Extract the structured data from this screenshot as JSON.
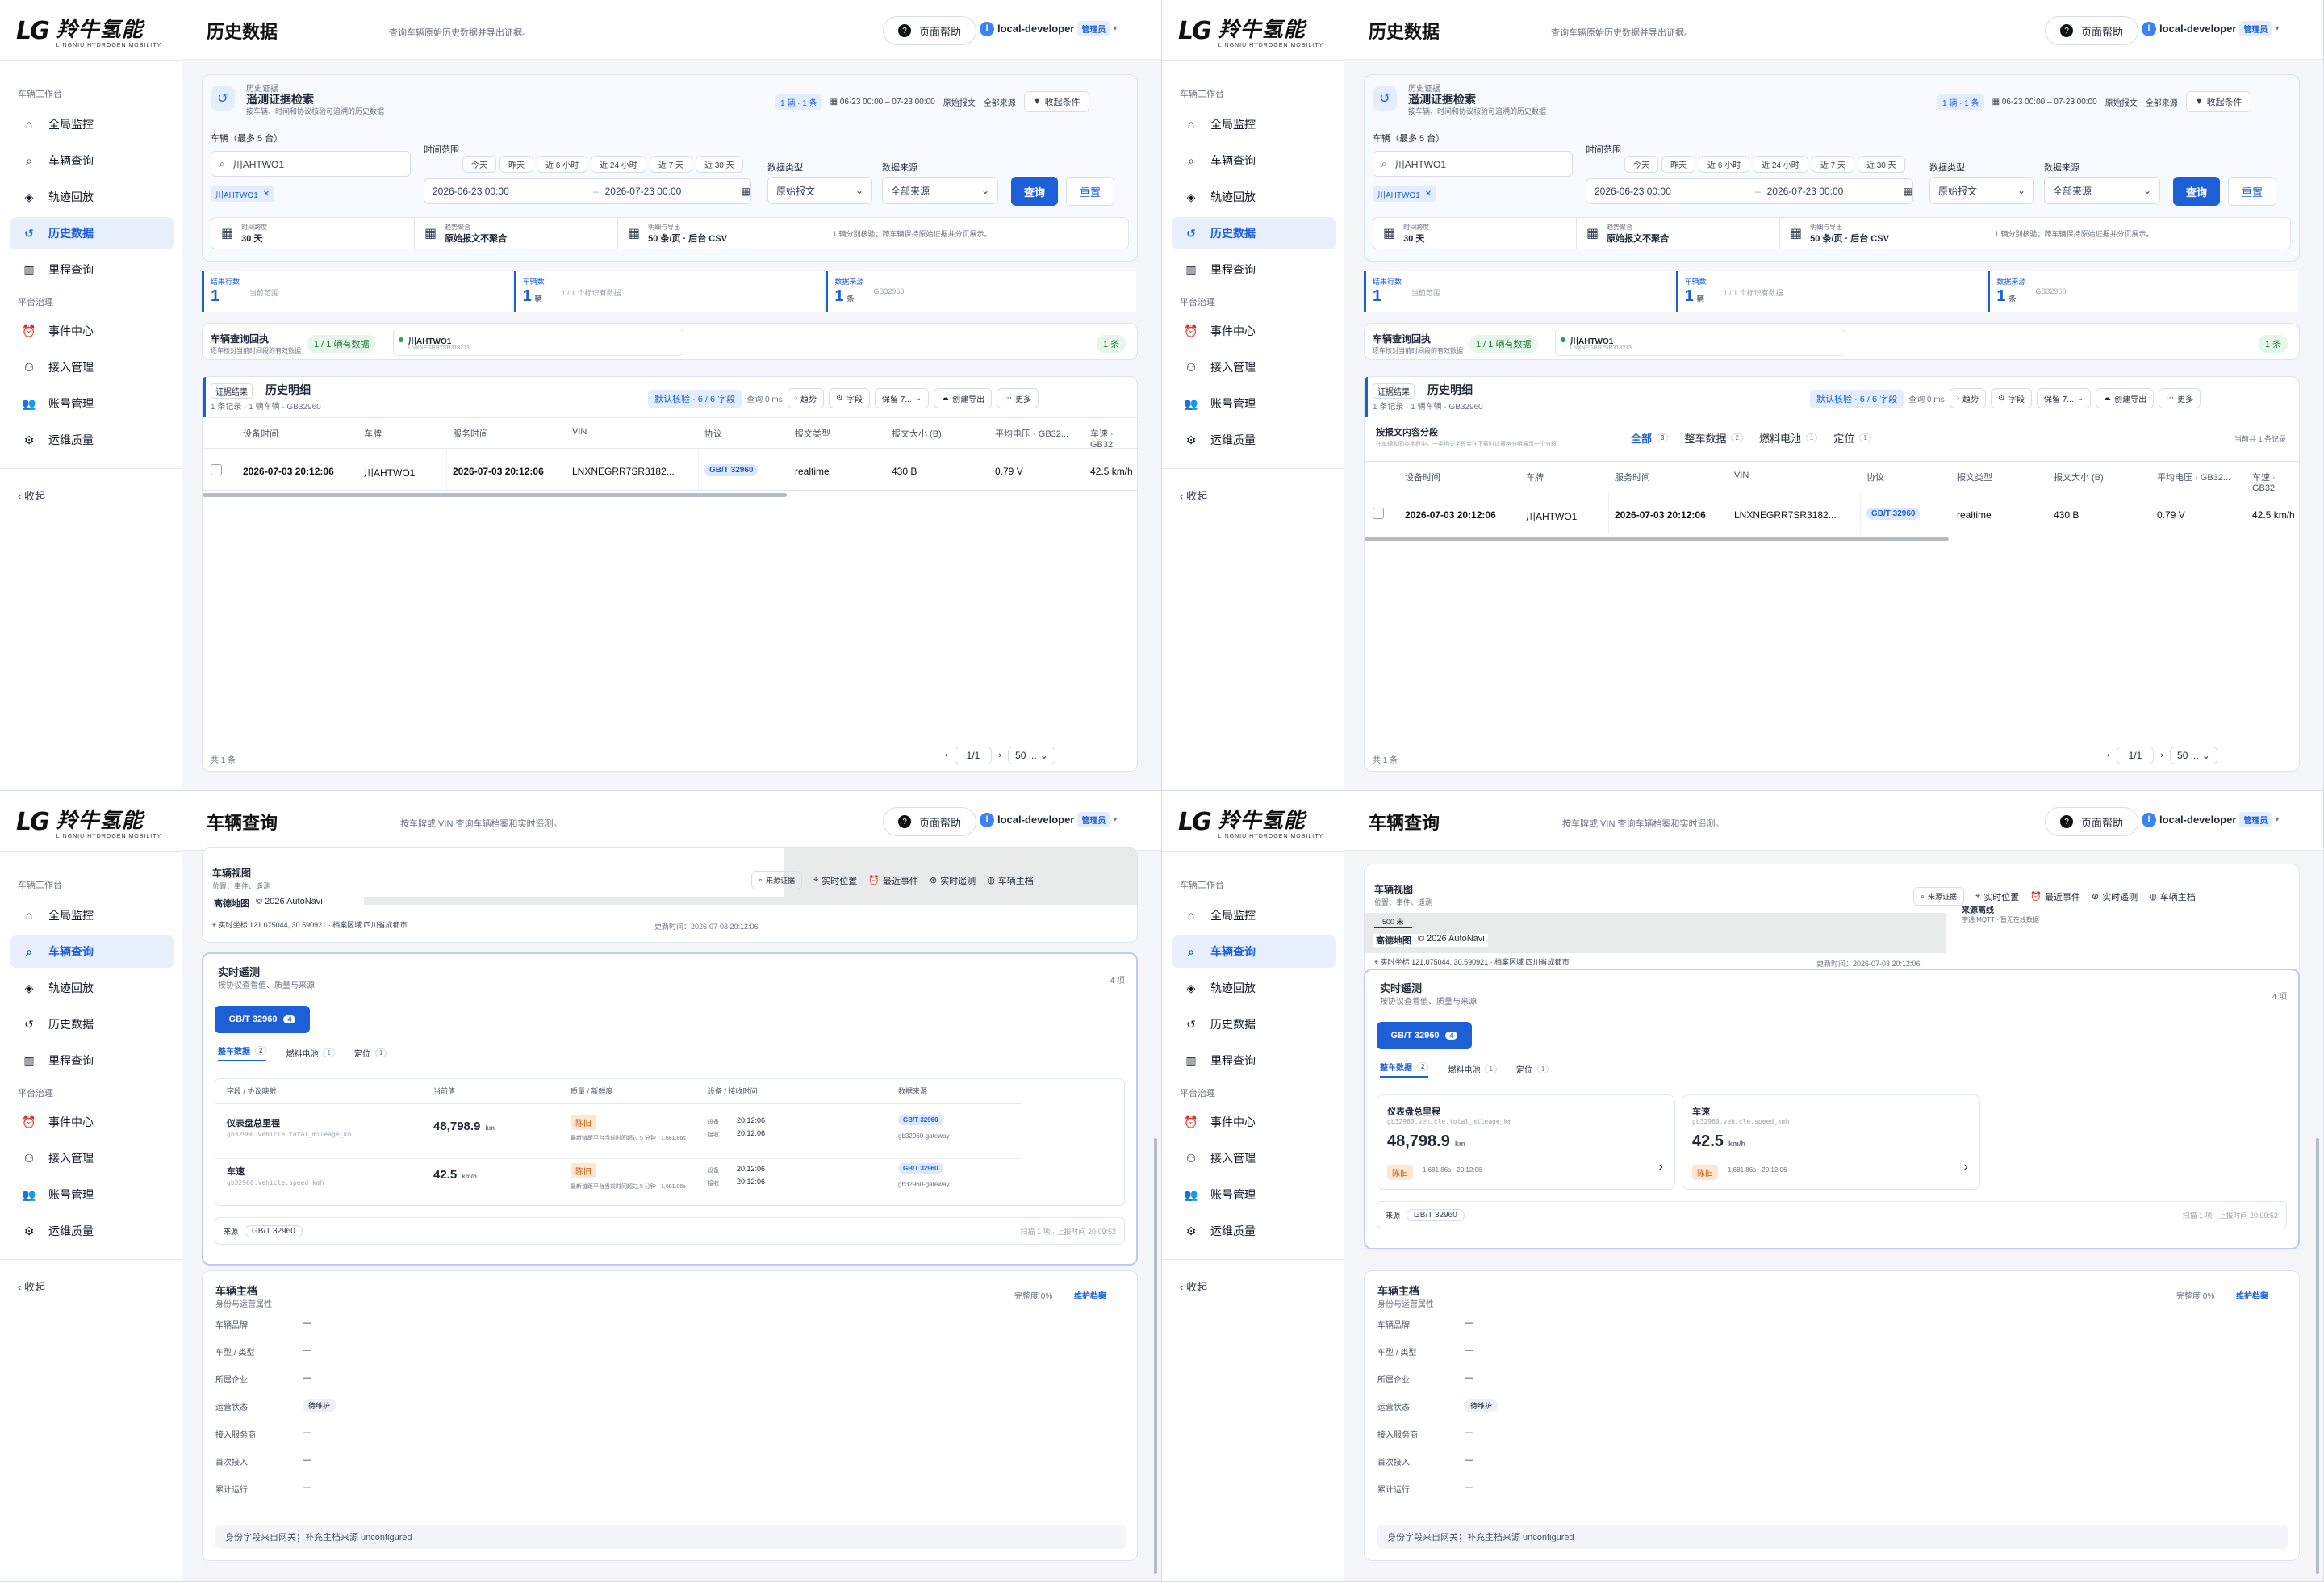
{
  "brand": {
    "mark": "LG",
    "name": "羚牛氢能",
    "en": "LINGNIU HYDROGEN MOBILITY"
  },
  "sidebar": {
    "section1": "车辆工作台",
    "section2": "平台治理",
    "items": [
      {
        "label": "全局监控",
        "icon": "home-icon"
      },
      {
        "label": "车辆查询",
        "icon": "search-icon"
      },
      {
        "label": "轨迹回放",
        "icon": "route-icon"
      },
      {
        "label": "历史数据",
        "icon": "history-icon"
      },
      {
        "label": "里程查询",
        "icon": "bar-chart-icon"
      }
    ],
    "items2": [
      {
        "label": "事件中心",
        "icon": "alarm-icon"
      },
      {
        "label": "接入管理",
        "icon": "plug-icon"
      },
      {
        "label": "账号管理",
        "icon": "users-icon"
      },
      {
        "label": "运维质量",
        "icon": "gear-icon"
      }
    ],
    "collapse": "收起"
  },
  "header": {
    "help": "页面帮助",
    "user": "local-developer",
    "role": "管理员",
    "avatar": "l"
  },
  "history": {
    "title": "历史数据",
    "subtitle": "查询车辆原始历史数据并导出证据。",
    "retrieve": {
      "eyebrow": "历史证据",
      "title": "遥测证据检索",
      "desc": "按车辆、时间和协议核验可追溯的历史数据",
      "stats": "1 辆 · 1 条",
      "range": "06-23 00:00 – 07-23 00:00",
      "raw": "原始报文",
      "src": "全部来源",
      "fold": "收起条件"
    },
    "filter": {
      "veh_label": "车辆（最多 5 台）",
      "veh_value": "川AHTWO1",
      "veh_chip": "川AHTWO1",
      "time_label": "时间范围",
      "quick": [
        "今天",
        "昨天",
        "近 6 小时",
        "近 24 小时",
        "近 7 天",
        "近 30 天"
      ],
      "start": "2026-06-23 00:00",
      "end": "2026-07-23 00:00",
      "dtype_label": "数据类型",
      "dtype": "原始报文",
      "src_label": "数据来源",
      "src": "全部来源",
      "query": "查询",
      "reset": "重置"
    },
    "meta": [
      {
        "k": "时间跨度",
        "v": "30 天"
      },
      {
        "k": "趋势聚合",
        "v": "原始报文不聚合"
      },
      {
        "k": "明细与导出",
        "v": "50 条/页 · 后台 CSV"
      }
    ],
    "meta_note": "1 辆分别核验；跨车辆保持原始证据并分页展示。",
    "kpis": [
      {
        "k": "结果行数",
        "v": "1",
        "n": "当前范围"
      },
      {
        "k": "车辆数",
        "v": "1",
        "u": "辆",
        "n": "1 / 1 个标识有数据"
      },
      {
        "k": "数据来源",
        "v": "1",
        "u": "条",
        "n": "GB32960"
      }
    ],
    "receipt": {
      "title": "车辆查询回执",
      "desc": "逐车核对当前时间段的有效数据",
      "badge": "1 / 1 辆有数据",
      "veh": "川AHTWO1",
      "vin": "LNXNEGRR7SR318213",
      "count": "1 条"
    },
    "detail": {
      "tag": "证据结果",
      "title": "历史明细",
      "sub": "1 条记录 · 1 辆车辆 · GB32960",
      "check": "默认核验 · 6 / 6 字段",
      "ms": "查询 0 ms",
      "trend": "趋势",
      "fields": "字段",
      "keep": "保留 7...",
      "export": "创建导出",
      "more": "更多"
    },
    "tabs_label": "按报文内容分段",
    "tabs_desc": "在车辆和同类字段中，一类相关字段会在下载时以表格分组展示一个分段。",
    "tabs": [
      {
        "t": "全部",
        "n": "3"
      },
      {
        "t": "整车数据",
        "n": "2"
      },
      {
        "t": "燃料电池",
        "n": "1"
      },
      {
        "t": "定位",
        "n": "1"
      }
    ],
    "tabs_note": "当前共 1 条记录",
    "cols": [
      "设备时间",
      "车牌",
      "服务时间",
      "VIN",
      "协议",
      "报文类型",
      "报文大小 (B)",
      "平均电压 · GB32...",
      "车速 · GB32"
    ],
    "row": [
      "2026-07-03 20:12:06",
      "川AHTWO1",
      "2026-07-03 20:12:06",
      "LNXNEGRR7SR3182...",
      "GB/T 32960",
      "realtime",
      "430 B",
      "0.79 V",
      "42.5 km/h"
    ],
    "total": "共 1 条",
    "page": "1/1",
    "size": "50 ..."
  },
  "vehicle": {
    "title": "车辆查询",
    "subtitle": "按车牌或 VIN 查询车辆档案和实时遥测。",
    "view": {
      "title": "车辆视图",
      "sub": "位置、事件、遥测",
      "btns": [
        "来源证据",
        "实时位置",
        "最近事件",
        "实时遥测",
        "车辆主档"
      ],
      "map": "高德地图",
      "copy": "© 2026 AutoNavi",
      "addr": "实时坐标 121.075044, 30.590921 · 档案区域 四川省成都市",
      "updated": "更新时间：2026-07-03 20:12:06",
      "scale": "500 米",
      "src_title": "来源离线",
      "src_sub": "宇通 MQTT · 暂无在线数据"
    },
    "rt": {
      "title": "实时遥测",
      "sub": "按协议查看值、质量与来源",
      "count": "4 项",
      "proto": "GB/T 32960",
      "proto_n": "4",
      "tabs": [
        {
          "t": "整车数据",
          "n": "2"
        },
        {
          "t": "燃料电池",
          "n": "1"
        },
        {
          "t": "定位",
          "n": "1"
        }
      ],
      "cols": [
        "字段 / 协议映射",
        "当前值",
        "质量 / 新鲜度",
        "设备 / 接收时间",
        "数据来源"
      ],
      "rows": [
        {
          "name": "仪表盘总里程",
          "key": "gb32960.vehicle.total_mileage_km",
          "val": "48,798.9",
          "unit": "km",
          "q": "陈旧",
          "qd": "最新值距平台当前时间超过 5 分钟 · 1,681.86s",
          "dev": "设备",
          "rec": "接收",
          "t1": "20:12:06",
          "t2": "20:12:06",
          "src": "GB/T 32960",
          "gw": "gb32960-gateway"
        },
        {
          "name": "车速",
          "key": "gb32960.vehicle.speed_kmh",
          "val": "42.5",
          "unit": "km/h",
          "q": "陈旧",
          "qd": "最新值距平台当前时间超过 5 分钟 · 1,681.86s",
          "dev": "设备",
          "rec": "接收",
          "t1": "20:12:06",
          "t2": "20:12:06",
          "src": "GB/T 32960",
          "gw": "gb32960-gateway"
        }
      ],
      "card_q": "陈旧",
      "card_qd1": "1,681.86s · 20:12:06",
      "card_qd2": "1,681.86s · 20:12:06",
      "foot": "来源",
      "foot_tag": "GB/T 32960",
      "foot_note": "扫描 1 项 · 上报时间 20:09:52"
    },
    "master": {
      "title": "车辆主档",
      "sub": "身份与运营属性",
      "complete": "完整度 0%",
      "maintain": "维护档案",
      "fields": [
        {
          "k": "车辆品牌",
          "v": "—"
        },
        {
          "k": "车型 / 类型",
          "v": "—"
        },
        {
          "k": "所属企业",
          "v": "—"
        },
        {
          "k": "运营状态",
          "v": "待维护"
        },
        {
          "k": "接入服务商",
          "v": "—"
        },
        {
          "k": "首次接入",
          "v": "—"
        },
        {
          "k": "累计运行",
          "v": "—"
        }
      ],
      "note": "身份字段来自网关；补充主档来源 unconfigured"
    }
  },
  "colors": {
    "accent": "#1d5fd6",
    "active_bg": "#e8f0fd",
    "warn": "#c2580a"
  }
}
